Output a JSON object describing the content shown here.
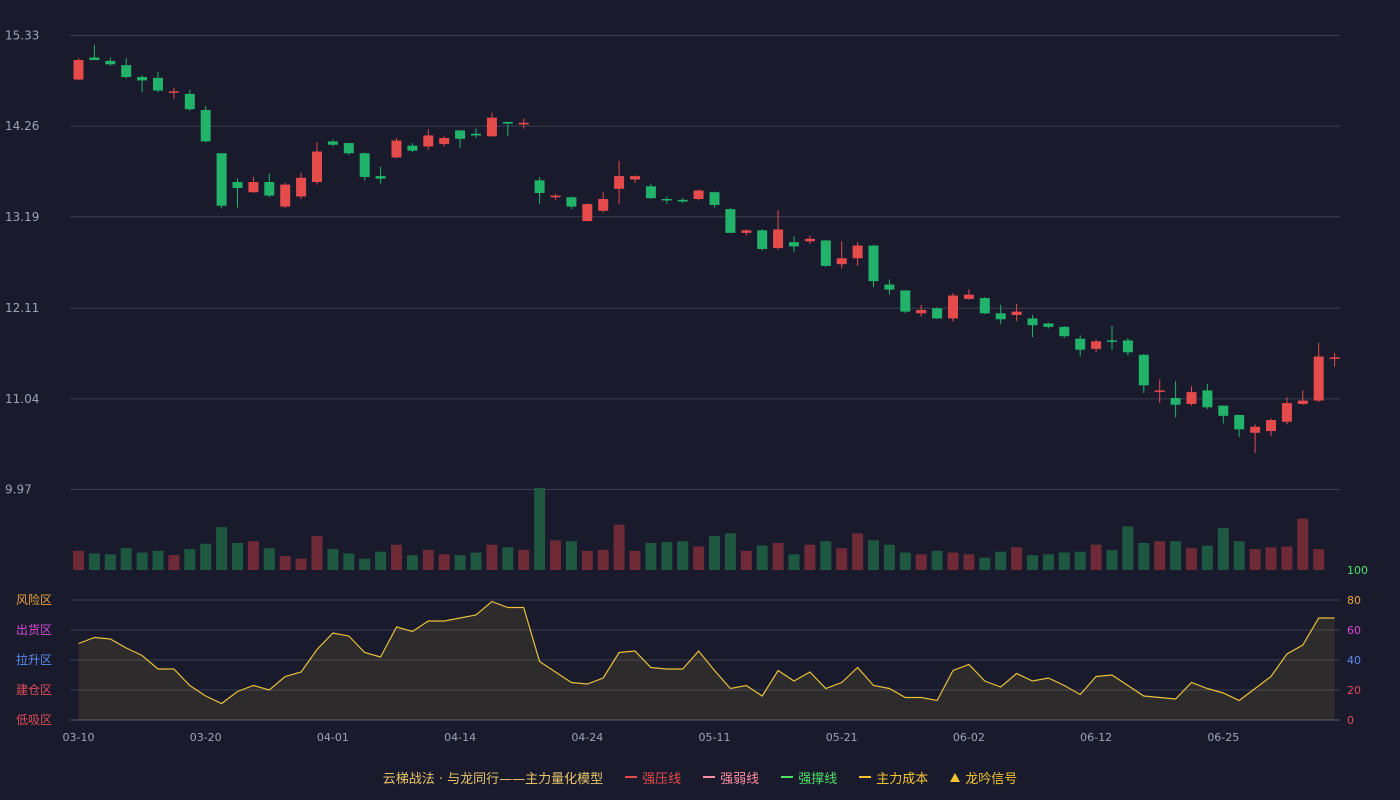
{
  "chart_data": [
    {
      "type": "candlestick",
      "title": "",
      "y_ticks": [
        "15.33",
        "14.26",
        "13.19",
        "12.11",
        "11.04",
        "9.97"
      ],
      "ylim": [
        9.97,
        15.33
      ],
      "x_ticks": [
        {
          "index": 0,
          "label": "03-10"
        },
        {
          "index": 8,
          "label": "03-20"
        },
        {
          "index": 16,
          "label": "04-01"
        },
        {
          "index": 24,
          "label": "04-14"
        },
        {
          "index": 32,
          "label": "04-24"
        },
        {
          "index": 40,
          "label": "05-11"
        },
        {
          "index": 48,
          "label": "05-21"
        },
        {
          "index": 56,
          "label": "06-02"
        },
        {
          "index": 64,
          "label": "06-12"
        },
        {
          "index": 72,
          "label": "06-25"
        }
      ],
      "ohlc": [
        [
          14.81,
          15.04,
          14.8,
          15.06,
          "up"
        ],
        [
          15.07,
          15.04,
          15.04,
          15.22,
          "down"
        ],
        [
          15.03,
          14.99,
          14.97,
          15.07,
          "down"
        ],
        [
          14.98,
          14.84,
          14.82,
          15.06,
          "down"
        ],
        [
          14.84,
          14.8,
          14.66,
          14.86,
          "down"
        ],
        [
          14.83,
          14.68,
          14.66,
          14.9,
          "down"
        ],
        [
          14.66,
          14.67,
          14.58,
          14.71,
          "up"
        ],
        [
          14.64,
          14.46,
          14.44,
          14.69,
          "down"
        ],
        [
          14.45,
          14.08,
          14.07,
          14.5,
          "down"
        ],
        [
          13.94,
          13.32,
          13.29,
          13.94,
          "down"
        ],
        [
          13.6,
          13.53,
          13.3,
          13.64,
          "down"
        ],
        [
          13.48,
          13.6,
          13.47,
          13.66,
          "up"
        ],
        [
          13.6,
          13.44,
          13.42,
          13.7,
          "down"
        ],
        [
          13.31,
          13.57,
          13.29,
          13.59,
          "up"
        ],
        [
          13.43,
          13.65,
          13.4,
          13.71,
          "up"
        ],
        [
          13.6,
          13.96,
          13.57,
          14.07,
          "up"
        ],
        [
          14.08,
          14.04,
          14.02,
          14.1,
          "down"
        ],
        [
          14.06,
          13.94,
          13.92,
          14.06,
          "down"
        ],
        [
          13.94,
          13.66,
          13.62,
          13.95,
          "down"
        ],
        [
          13.67,
          13.64,
          13.58,
          13.78,
          "down"
        ],
        [
          13.89,
          14.09,
          13.88,
          14.12,
          "up"
        ],
        [
          14.03,
          13.97,
          13.95,
          14.06,
          "down"
        ],
        [
          14.02,
          14.15,
          13.98,
          14.22,
          "up"
        ],
        [
          14.05,
          14.12,
          14.02,
          14.14,
          "up"
        ],
        [
          14.21,
          14.11,
          14.0,
          14.21,
          "down"
        ],
        [
          14.17,
          14.15,
          14.12,
          14.23,
          "down"
        ],
        [
          14.14,
          14.36,
          14.14,
          14.42,
          "up"
        ],
        [
          14.31,
          14.29,
          14.14,
          14.31,
          "down"
        ],
        [
          14.28,
          14.3,
          14.23,
          14.35,
          "up"
        ],
        [
          13.62,
          13.47,
          13.34,
          13.66,
          "down"
        ],
        [
          13.42,
          13.44,
          13.39,
          13.46,
          "up"
        ],
        [
          13.42,
          13.31,
          13.28,
          13.43,
          "down"
        ],
        [
          13.14,
          13.34,
          13.13,
          13.35,
          "up"
        ],
        [
          13.26,
          13.4,
          13.24,
          13.48,
          "up"
        ],
        [
          13.52,
          13.67,
          13.34,
          13.85,
          "up"
        ],
        [
          13.63,
          13.67,
          13.59,
          13.68,
          "up"
        ],
        [
          13.55,
          13.41,
          13.4,
          13.58,
          "down"
        ],
        [
          13.4,
          13.39,
          13.34,
          13.43,
          "down"
        ],
        [
          13.39,
          13.37,
          13.35,
          13.41,
          "down"
        ],
        [
          13.4,
          13.5,
          13.38,
          13.51,
          "up"
        ],
        [
          13.48,
          13.33,
          13.3,
          13.49,
          "down"
        ],
        [
          13.28,
          13.0,
          13.0,
          13.29,
          "down"
        ],
        [
          13.0,
          13.03,
          12.97,
          13.04,
          "up"
        ],
        [
          13.03,
          12.81,
          12.79,
          13.04,
          "down"
        ],
        [
          12.82,
          13.04,
          12.8,
          13.27,
          "up"
        ],
        [
          12.89,
          12.84,
          12.77,
          12.96,
          "down"
        ],
        [
          12.9,
          12.93,
          12.87,
          12.97,
          "up"
        ],
        [
          12.91,
          12.61,
          12.6,
          12.92,
          "down"
        ],
        [
          12.63,
          12.7,
          12.58,
          12.9,
          "up"
        ],
        [
          12.7,
          12.85,
          12.61,
          12.89,
          "up"
        ],
        [
          12.85,
          12.43,
          12.36,
          12.86,
          "down"
        ],
        [
          12.39,
          12.33,
          12.27,
          12.45,
          "down"
        ],
        [
          12.32,
          12.07,
          12.05,
          12.32,
          "down"
        ],
        [
          12.05,
          12.09,
          12.01,
          12.15,
          "up"
        ],
        [
          12.11,
          11.99,
          11.98,
          12.12,
          "down"
        ],
        [
          11.99,
          12.26,
          11.95,
          12.29,
          "up"
        ],
        [
          12.22,
          12.27,
          12.21,
          12.33,
          "up"
        ],
        [
          12.23,
          12.05,
          12.04,
          12.24,
          "down"
        ],
        [
          12.05,
          11.98,
          11.92,
          12.15,
          "down"
        ],
        [
          12.03,
          12.07,
          11.96,
          12.16,
          "up"
        ],
        [
          11.99,
          11.91,
          11.77,
          12.03,
          "down"
        ],
        [
          11.93,
          11.89,
          11.87,
          11.94,
          "down"
        ],
        [
          11.89,
          11.78,
          11.76,
          11.9,
          "down"
        ],
        [
          11.75,
          11.62,
          11.54,
          11.79,
          "down"
        ],
        [
          11.63,
          11.72,
          11.59,
          11.74,
          "up"
        ],
        [
          11.73,
          11.72,
          11.62,
          11.9,
          "down"
        ],
        [
          11.73,
          11.59,
          11.55,
          11.76,
          "down"
        ],
        [
          11.56,
          11.2,
          11.11,
          11.57,
          "down"
        ],
        [
          11.14,
          11.13,
          10.99,
          11.27,
          "up"
        ],
        [
          11.05,
          10.97,
          10.82,
          11.25,
          "down"
        ],
        [
          10.98,
          11.12,
          10.96,
          11.19,
          "up"
        ],
        [
          11.14,
          10.94,
          10.92,
          11.22,
          "down"
        ],
        [
          10.96,
          10.84,
          10.75,
          10.96,
          "down"
        ],
        [
          10.85,
          10.68,
          10.59,
          10.85,
          "down"
        ],
        [
          10.64,
          10.71,
          10.4,
          10.74,
          "up"
        ],
        [
          10.66,
          10.79,
          10.6,
          10.81,
          "up"
        ],
        [
          10.77,
          10.99,
          10.74,
          11.06,
          "up"
        ],
        [
          10.98,
          11.02,
          10.97,
          11.14,
          "up"
        ],
        [
          11.02,
          11.54,
          11.0,
          11.7,
          "up"
        ],
        [
          11.53,
          11.52,
          11.42,
          11.58,
          "up"
        ]
      ],
      "up_color": "#e64b4b",
      "down_color": "#22b36a",
      "grid": true
    },
    {
      "type": "bar",
      "title": "",
      "values": [
        22,
        19,
        18,
        25,
        20,
        22,
        17,
        24,
        30,
        49,
        31,
        33,
        25,
        16,
        13,
        39,
        24,
        19,
        13,
        21,
        29,
        17,
        23,
        18,
        17,
        20,
        29,
        26,
        23,
        94,
        34,
        33,
        22,
        23,
        52,
        22,
        31,
        32,
        33,
        27,
        39,
        42,
        22,
        28,
        31,
        18,
        29,
        33,
        25,
        42,
        34,
        29,
        20,
        18,
        22,
        20,
        18,
        14,
        21,
        26,
        17,
        18,
        20,
        21,
        29,
        23,
        50,
        31,
        33,
        33,
        25,
        28,
        48,
        33,
        24,
        26,
        27,
        59,
        24
      ],
      "up_color": "#6e2a36",
      "down_color": "#1e5840"
    },
    {
      "type": "area",
      "title": "",
      "y_ticks": [
        "0",
        "20",
        "40",
        "60",
        "80",
        "100"
      ],
      "zone_labels": [
        "低吸区",
        "建仓区",
        "拉升区",
        "出货区",
        "风险区"
      ],
      "ylim": [
        0,
        100
      ],
      "values": [
        51,
        55,
        54,
        48,
        43,
        34,
        34,
        23,
        16,
        11,
        19,
        23,
        20,
        29,
        32,
        47,
        58,
        56,
        45,
        42,
        62,
        59,
        66,
        66,
        68,
        70,
        79,
        75,
        75,
        39,
        32,
        25,
        24,
        28,
        45,
        46,
        35,
        34,
        34,
        46,
        33,
        21,
        23,
        16,
        33,
        26,
        32,
        21,
        25,
        35,
        23,
        21,
        15,
        15,
        13,
        33,
        37,
        26,
        22,
        31,
        26,
        28,
        23,
        17,
        29,
        30,
        23,
        16,
        15,
        14,
        25,
        21,
        18,
        13,
        21,
        29,
        44,
        50,
        68,
        68
      ],
      "line_color": "#e8c03a"
    }
  ],
  "legend": {
    "title": "云梯战法 · 与龙同行——主力量化模型",
    "items": [
      {
        "label": "强压线",
        "color": "#e64b4b",
        "style": "solid"
      },
      {
        "label": "强弱线",
        "color": "#ff8fa3",
        "style": "dashed"
      },
      {
        "label": "强撑线",
        "color": "#4ee06a",
        "style": "solid"
      },
      {
        "label": "主力成本",
        "color": "#f2c531",
        "style": "dashed"
      },
      {
        "label": "龙吟信号",
        "color": "#f2c531",
        "style": "triangle"
      }
    ]
  },
  "colors": {
    "grid": "#3b3d52",
    "axis_text": "#9ea3b8",
    "zone_low": "#e04c5a",
    "zone_build": "#e04c5a",
    "zone_pull": "#5b8def",
    "zone_ship": "#d44cd8",
    "zone_risk": "#e8a23a",
    "tick100": "#4ee06a",
    "tick80": "#e8a23a",
    "tick60": "#d44cd8",
    "tick40": "#5b8def",
    "tick20": "#e04c5a",
    "tick0": "#e04c5a"
  }
}
